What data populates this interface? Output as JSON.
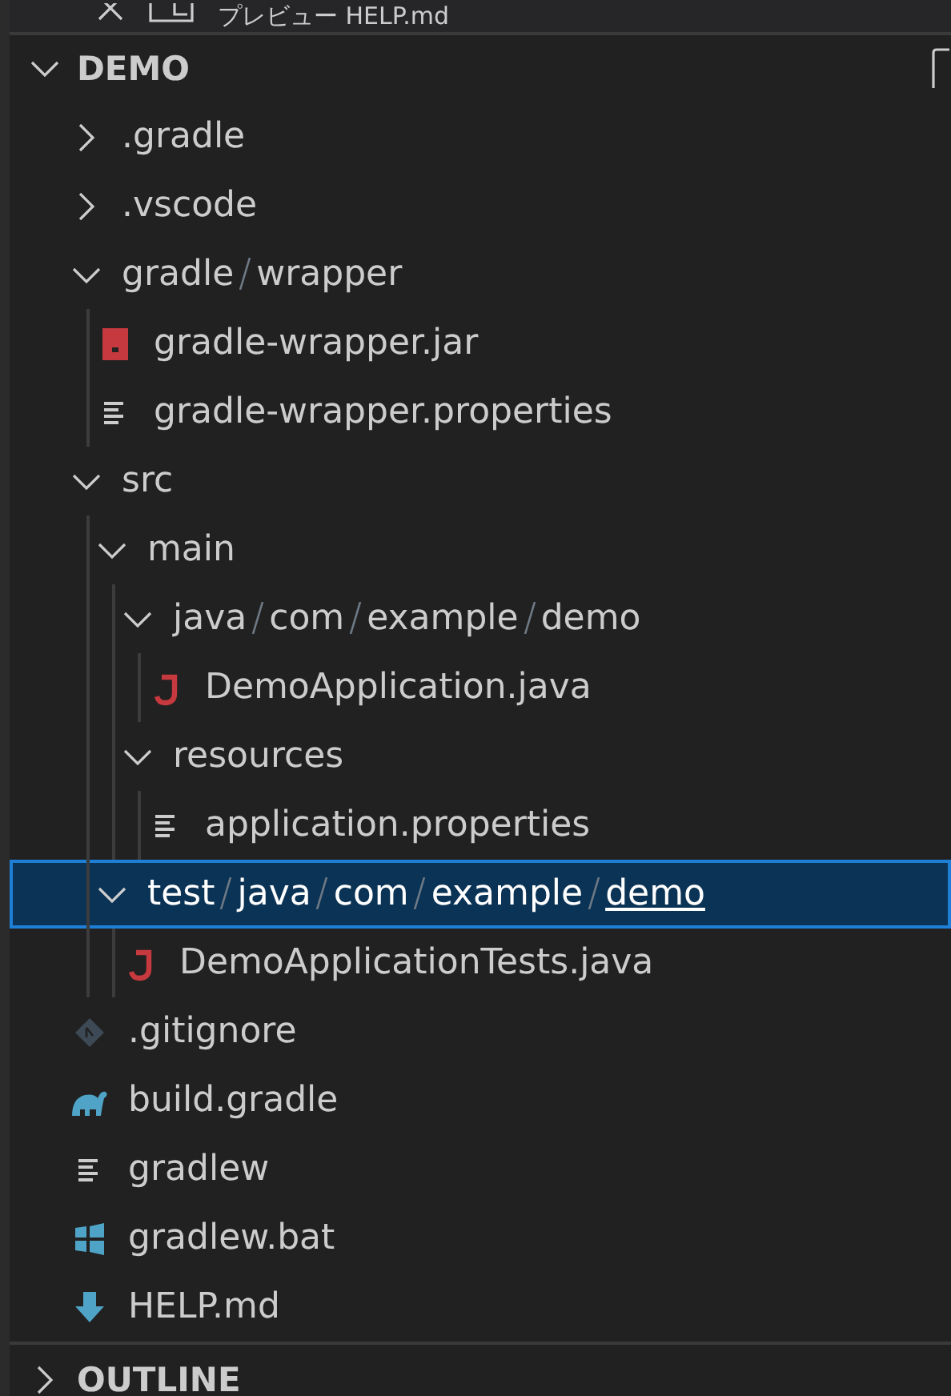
{
  "top_tab": {
    "title": "プレビュー HELP.md"
  },
  "explorer": {
    "title": "DEMO",
    "expanded": true
  },
  "tree": [
    {
      "kind": "folder",
      "segments": [
        ".gradle"
      ],
      "expanded": false,
      "selected": false
    },
    {
      "kind": "folder",
      "segments": [
        ".vscode"
      ],
      "expanded": false,
      "selected": false
    },
    {
      "kind": "folder",
      "segments": [
        "gradle",
        "wrapper"
      ],
      "expanded": true,
      "selected": false,
      "children": [
        {
          "kind": "jar",
          "name": "gradle-wrapper.jar",
          "selected": false
        },
        {
          "kind": "text",
          "name": "gradle-wrapper.properties",
          "selected": false
        }
      ]
    },
    {
      "kind": "folder",
      "segments": [
        "src"
      ],
      "expanded": true,
      "selected": false,
      "children": [
        {
          "kind": "folder",
          "segments": [
            "main"
          ],
          "expanded": true,
          "selected": false,
          "children": [
            {
              "kind": "folder",
              "segments": [
                "java",
                "com",
                "example",
                "demo"
              ],
              "expanded": true,
              "selected": false,
              "children": [
                {
                  "kind": "java",
                  "name": "DemoApplication.java",
                  "selected": false
                }
              ]
            },
            {
              "kind": "folder",
              "segments": [
                "resources"
              ],
              "expanded": true,
              "selected": false,
              "children": [
                {
                  "kind": "text",
                  "name": "application.properties",
                  "selected": false
                }
              ]
            }
          ]
        },
        {
          "kind": "folder",
          "segments": [
            "test",
            "java",
            "com",
            "example",
            "demo"
          ],
          "expanded": true,
          "selected": true,
          "children": [
            {
              "kind": "java",
              "name": "DemoApplicationTests.java",
              "selected": false
            }
          ]
        }
      ]
    },
    {
      "kind": "git",
      "name": ".gitignore",
      "selected": false
    },
    {
      "kind": "gradle",
      "name": "build.gradle",
      "selected": false
    },
    {
      "kind": "text",
      "name": "gradlew",
      "selected": false
    },
    {
      "kind": "windows",
      "name": "gradlew.bat",
      "selected": false
    },
    {
      "kind": "markdown",
      "name": "HELP.md",
      "selected": false
    }
  ],
  "outline": {
    "title": "OUTLINE",
    "expanded": false
  }
}
